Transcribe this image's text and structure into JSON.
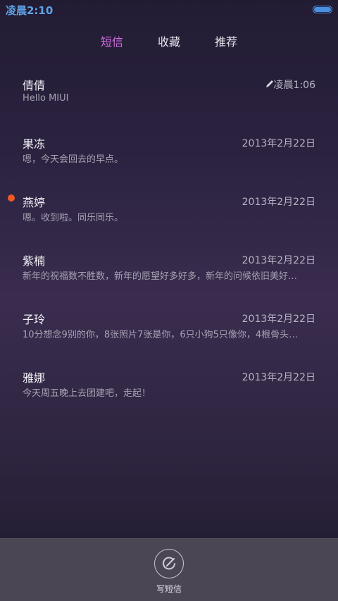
{
  "status_bar": {
    "time": "凌晨2:10"
  },
  "tabs": [
    {
      "label": "短信",
      "active": true
    },
    {
      "label": "收藏",
      "active": false
    },
    {
      "label": "推荐",
      "active": false
    }
  ],
  "conversations": [
    {
      "name": "倩倩",
      "date": "凌晨1:06",
      "preview": "Hello MIUI",
      "unread": false,
      "draft": true
    },
    {
      "name": "果冻",
      "date": "2013年2月22日",
      "preview": "嗯，今天会回去的早点。",
      "unread": false,
      "draft": false
    },
    {
      "name": "燕婷",
      "date": "2013年2月22日",
      "preview": "嗯。收到啦。同乐同乐。",
      "unread": true,
      "draft": false
    },
    {
      "name": "紫楠",
      "date": "2013年2月22日",
      "preview": "新年的祝福数不胜数，新年的愿望好多好多，新年的问候依旧美好…",
      "unread": false,
      "draft": false
    },
    {
      "name": "子玲",
      "date": "2013年2月22日",
      "preview": "10分想念9别的你，8张照片7张是你，6只小狗5只像你，4根骨头…",
      "unread": false,
      "draft": false
    },
    {
      "name": "雅娜",
      "date": "2013年2月22日",
      "preview": "今天周五晚上去团建吧，走起！",
      "unread": false,
      "draft": false
    }
  ],
  "bottom_bar": {
    "compose_label": "写短信"
  },
  "colors": {
    "accent": "#d46ee6",
    "unread": "#f15a23",
    "status_time": "#5fa2e6"
  }
}
